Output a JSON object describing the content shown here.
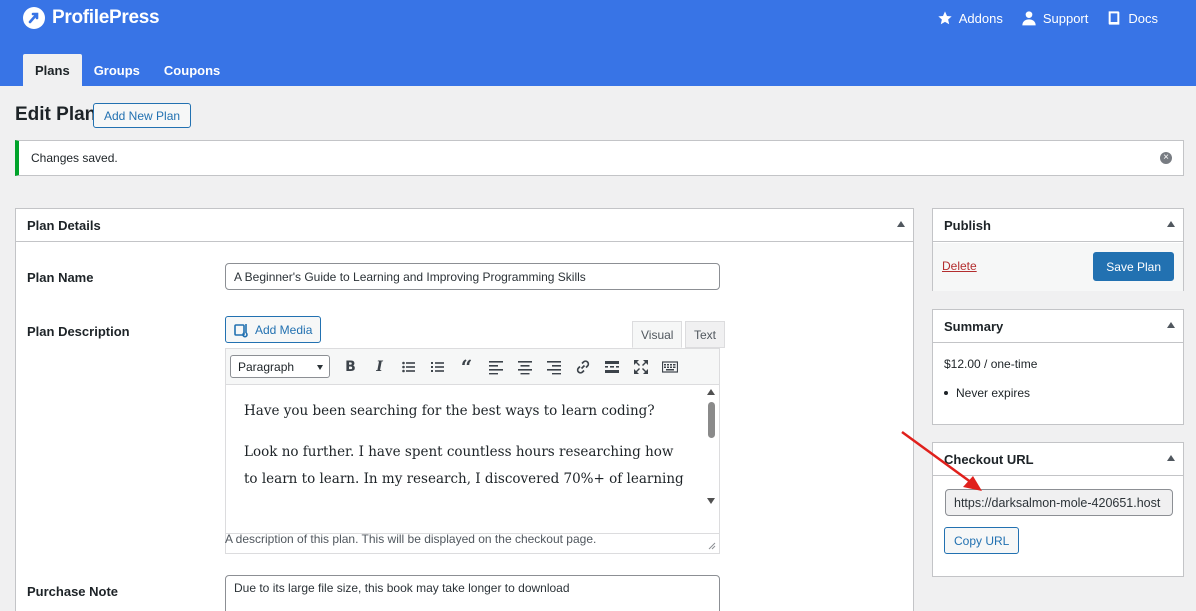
{
  "header": {
    "brand": "ProfilePress",
    "links": [
      {
        "label": "Addons",
        "icon": "star-icon"
      },
      {
        "label": "Support",
        "icon": "user-icon"
      },
      {
        "label": "Docs",
        "icon": "book-icon"
      }
    ],
    "tabs": [
      {
        "label": "Plans",
        "active": true
      },
      {
        "label": "Groups",
        "active": false
      },
      {
        "label": "Coupons",
        "active": false
      }
    ],
    "color": "#3874e6"
  },
  "page": {
    "title": "Edit Plan",
    "add_new_label": "Add New Plan"
  },
  "notice": {
    "text": "Changes saved.",
    "accent": "#00a32a"
  },
  "plan_details": {
    "heading": "Plan Details",
    "plan_name_label": "Plan Name",
    "plan_name_value": "A Beginner's Guide to Learning and Improving Programming Skills",
    "description_label": "Plan Description",
    "add_media_label": "Add Media",
    "editor_tabs": [
      "Visual",
      "Text"
    ],
    "format_select": "Paragraph",
    "toolbar_icons": [
      "bold-icon",
      "italic-icon",
      "bullet-list-icon",
      "numbered-list-icon",
      "blockquote-icon",
      "align-left-icon",
      "align-center-icon",
      "align-right-icon",
      "link-icon",
      "read-more-icon",
      "fullscreen-icon",
      "toolbar-toggle-icon"
    ],
    "editor_paragraphs": [
      "Have you been searching for the best ways to learn coding?",
      "Look no further. I have spent countless hours researching how to learn to learn. In my research, I discovered 70%+ of learning"
    ],
    "description_help": "A description of this plan. This will be displayed on the checkout page.",
    "purchase_note_label": "Purchase Note",
    "purchase_note_value": "Due to its large file size, this book may take longer to download"
  },
  "publish": {
    "heading": "Publish",
    "delete_label": "Delete",
    "save_label": "Save Plan"
  },
  "summary": {
    "heading": "Summary",
    "price": "$12.00 / one-time",
    "items": [
      "Never expires"
    ]
  },
  "checkout": {
    "heading": "Checkout URL",
    "url": "https://darksalmon-mole-420651.host",
    "copy_label": "Copy URL"
  }
}
